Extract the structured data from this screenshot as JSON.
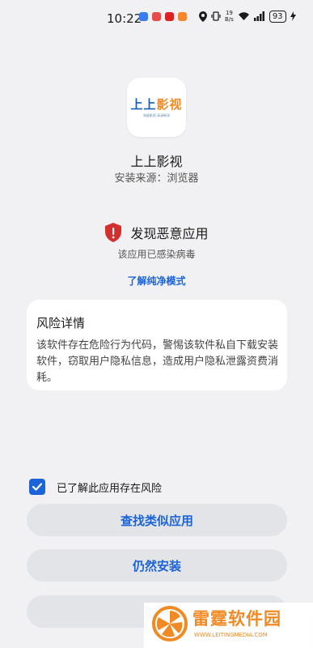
{
  "status_bar": {
    "time": "10:22",
    "net_speed_value": "19",
    "net_speed_unit": "B/s",
    "battery": "93"
  },
  "app": {
    "logo_text_part1": "上上",
    "logo_text_part2": "影视",
    "logo_tagline": "海量影视 高清畅享",
    "name": "上上影视",
    "install_source": "安装来源：浏览器"
  },
  "warning": {
    "title": "发现恶意应用",
    "subtitle": "该应用已感染病毒",
    "link": "了解纯净模式",
    "color": "#d32f2f"
  },
  "risk": {
    "title": "风险详情",
    "description": "该软件存在危险行为代码，警惕该软件私自下载安装软件，窃取用户隐私信息，造成用户隐私泄露资费消耗。"
  },
  "consent": {
    "checked": true,
    "label": "已了解此应用存在风险"
  },
  "buttons": {
    "find_similar": "查找类似应用",
    "install_anyway": "仍然安装",
    "cancel": "取消"
  },
  "watermark": {
    "title": "雷霆软件园",
    "url": "WWW.LEITINGMEDIA.COM"
  },
  "colors": {
    "accent": "#1b63d6",
    "background": "#f1f1f3",
    "watermark": "#f08a24"
  }
}
